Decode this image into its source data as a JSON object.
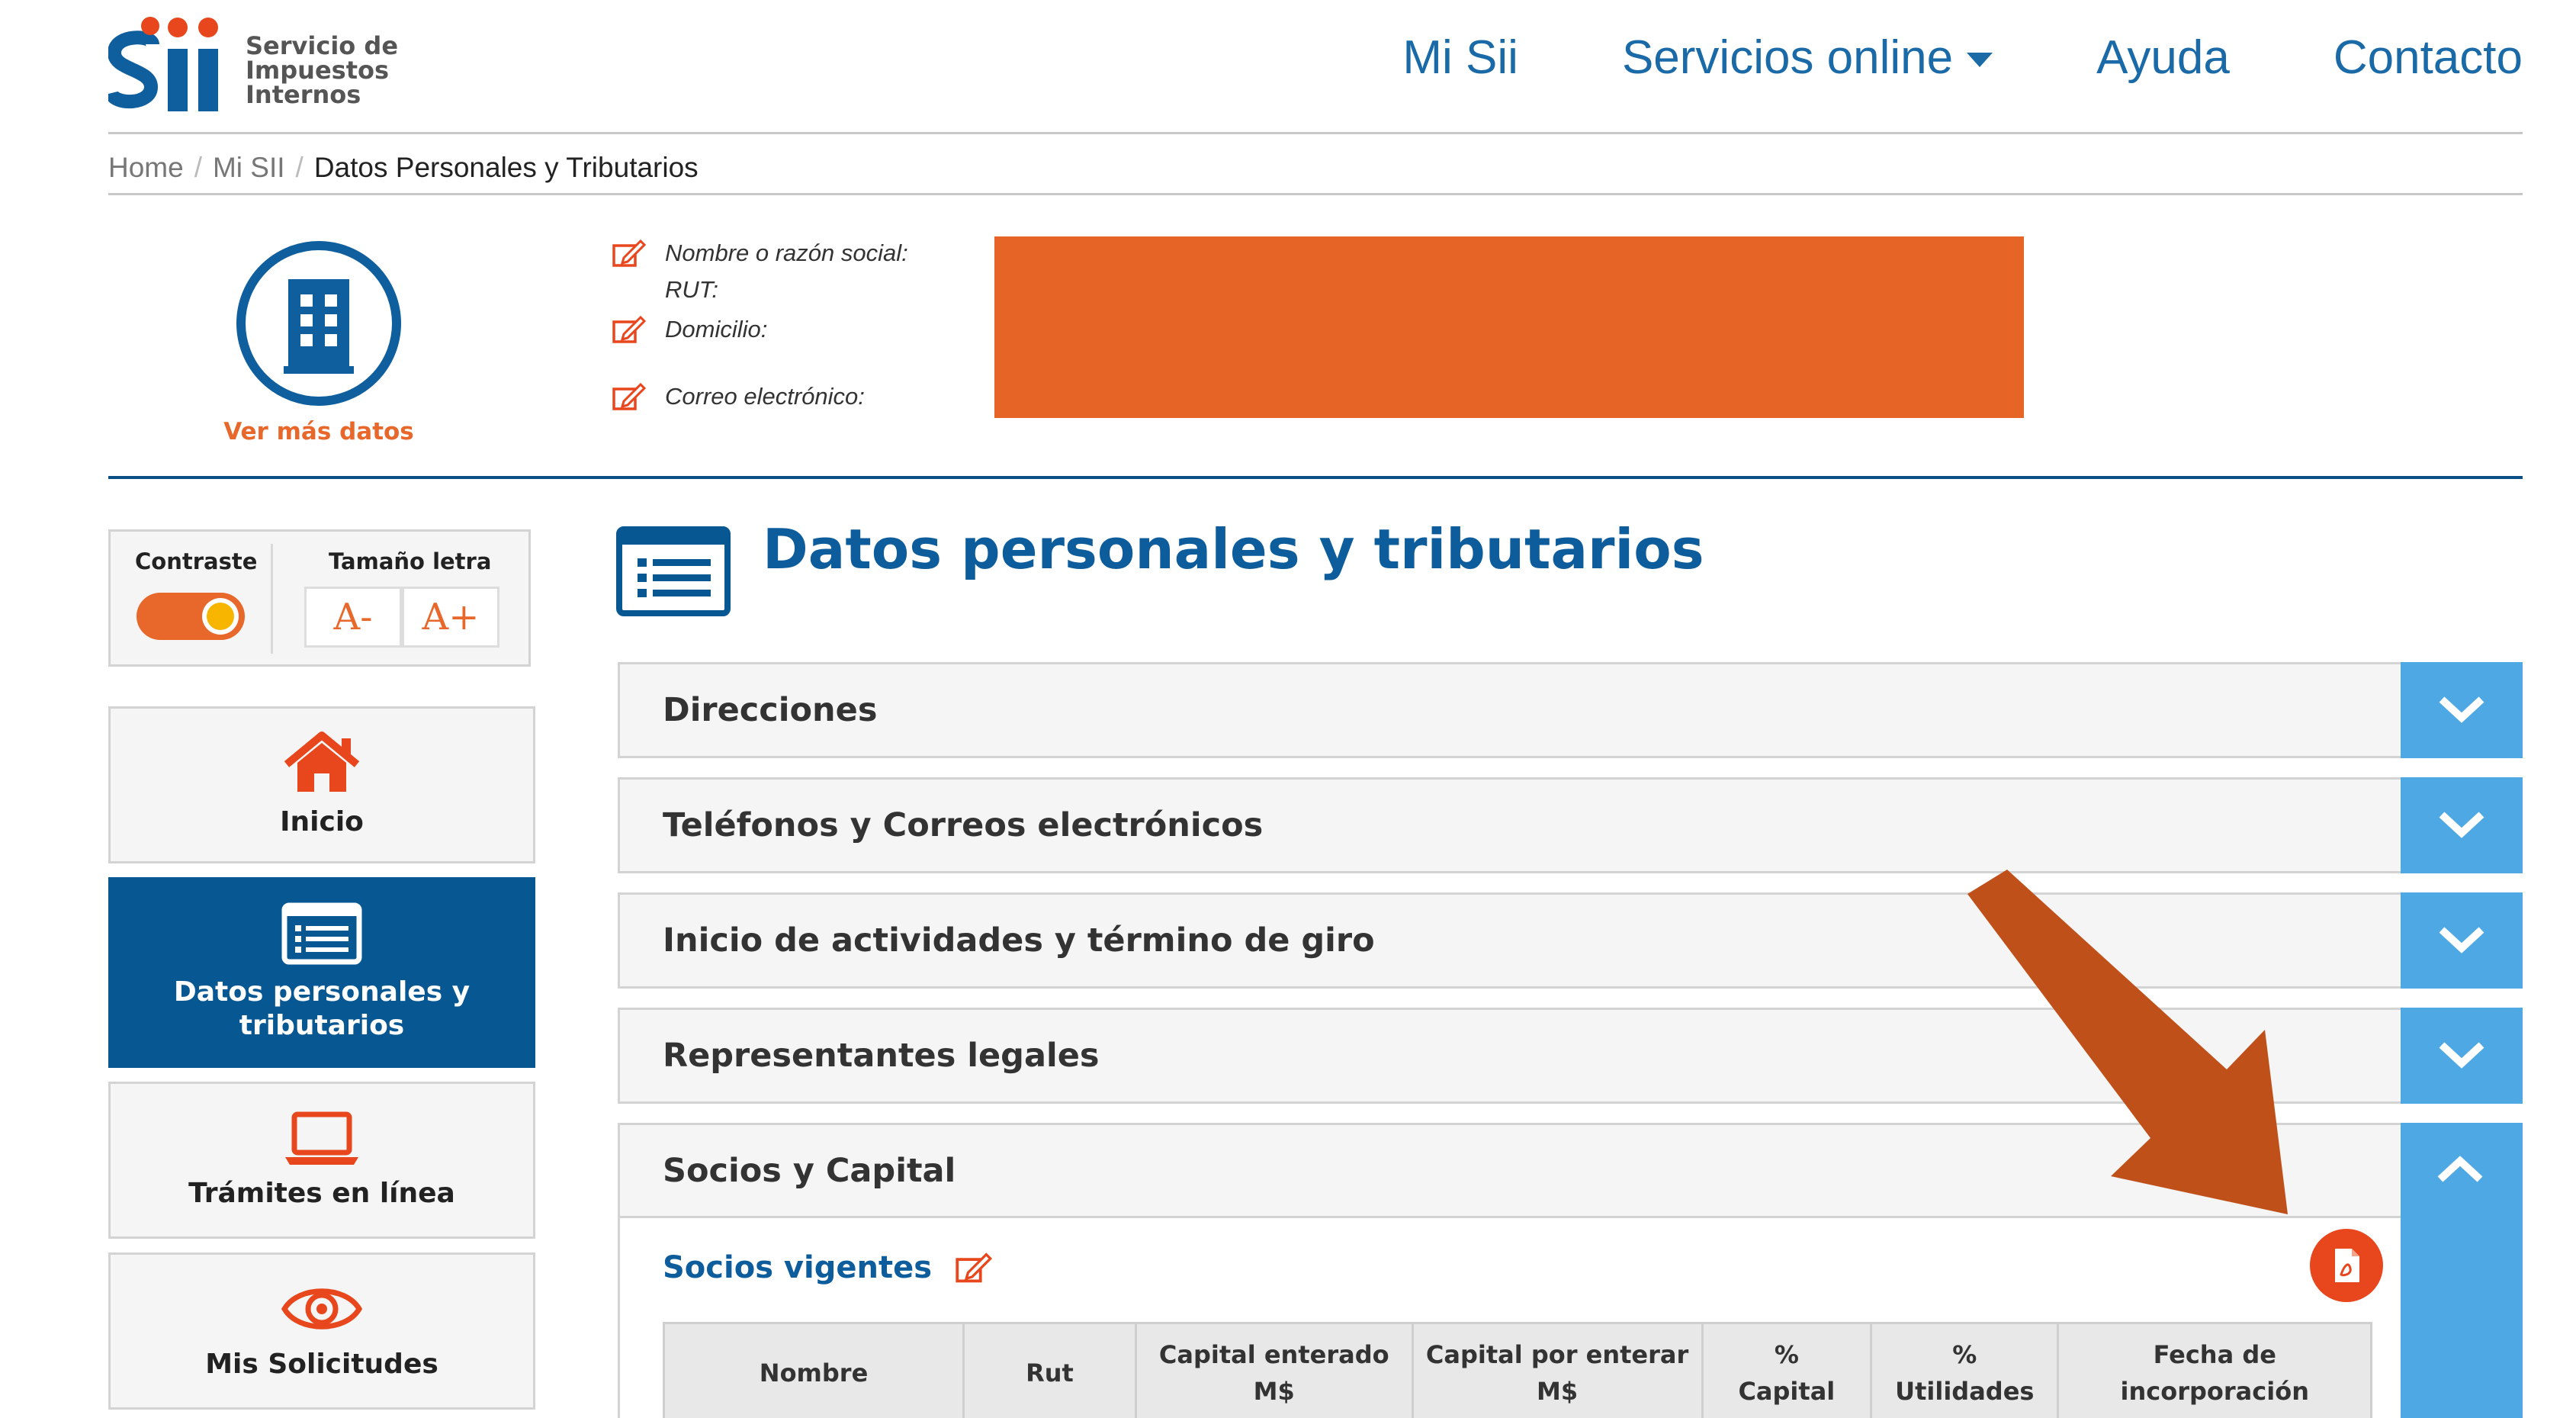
{
  "header": {
    "logo_text": [
      "Servicio de",
      "Impuestos",
      "Internos"
    ],
    "logo_letters": "Sii",
    "nav": [
      {
        "label": "Mi Sii"
      },
      {
        "label": "Servicios online",
        "has_caret": true
      },
      {
        "label": "Ayuda"
      },
      {
        "label": "Contacto"
      }
    ]
  },
  "breadcrumb": [
    "Home",
    "Mi SII",
    "Datos Personales y Tributarios"
  ],
  "profile": {
    "ver_mas": "Ver más datos",
    "fields": {
      "nombre": "Nombre o razón social:",
      "rut": "RUT:",
      "domicilio": "Domicilio:",
      "correo": "Correo electrónico:"
    },
    "redaction_color": "#e66426"
  },
  "controls": {
    "contraste": "Contraste",
    "tamano": "Tamaño letra",
    "decrease": "A-",
    "increase": "A+"
  },
  "menu": [
    {
      "label": "Inicio",
      "icon": "home-icon"
    },
    {
      "label_lines": [
        "Datos personales y",
        "tributarios"
      ],
      "icon": "list-icon",
      "active": true
    },
    {
      "label": "Trámites en línea",
      "icon": "laptop-icon"
    },
    {
      "label": "Mis Solicitudes",
      "icon": "eye-icon"
    }
  ],
  "main": {
    "title": "Datos personales y tributarios",
    "sections": [
      {
        "label": "Direcciones"
      },
      {
        "label": "Teléfonos y Correos electrónicos"
      },
      {
        "label": "Inicio de actividades y término de giro"
      },
      {
        "label": "Representantes legales"
      },
      {
        "label": "Socios y Capital",
        "open": true
      }
    ],
    "socios": {
      "link": "Socios vigentes",
      "columns": [
        [
          "Nombre"
        ],
        [
          "Rut"
        ],
        [
          "Capital enterado",
          "M$"
        ],
        [
          "Capital por enterar",
          "M$"
        ],
        [
          "%",
          "Capital"
        ],
        [
          "%",
          "Utilidades"
        ],
        [
          "Fecha de",
          "incorporación"
        ]
      ]
    }
  },
  "colors": {
    "brand_blue": "#0d5d9c",
    "accent_orange": "#e8672a",
    "accordion_blue": "#4ea8e4",
    "annotation_arrow": "#c0501a"
  }
}
